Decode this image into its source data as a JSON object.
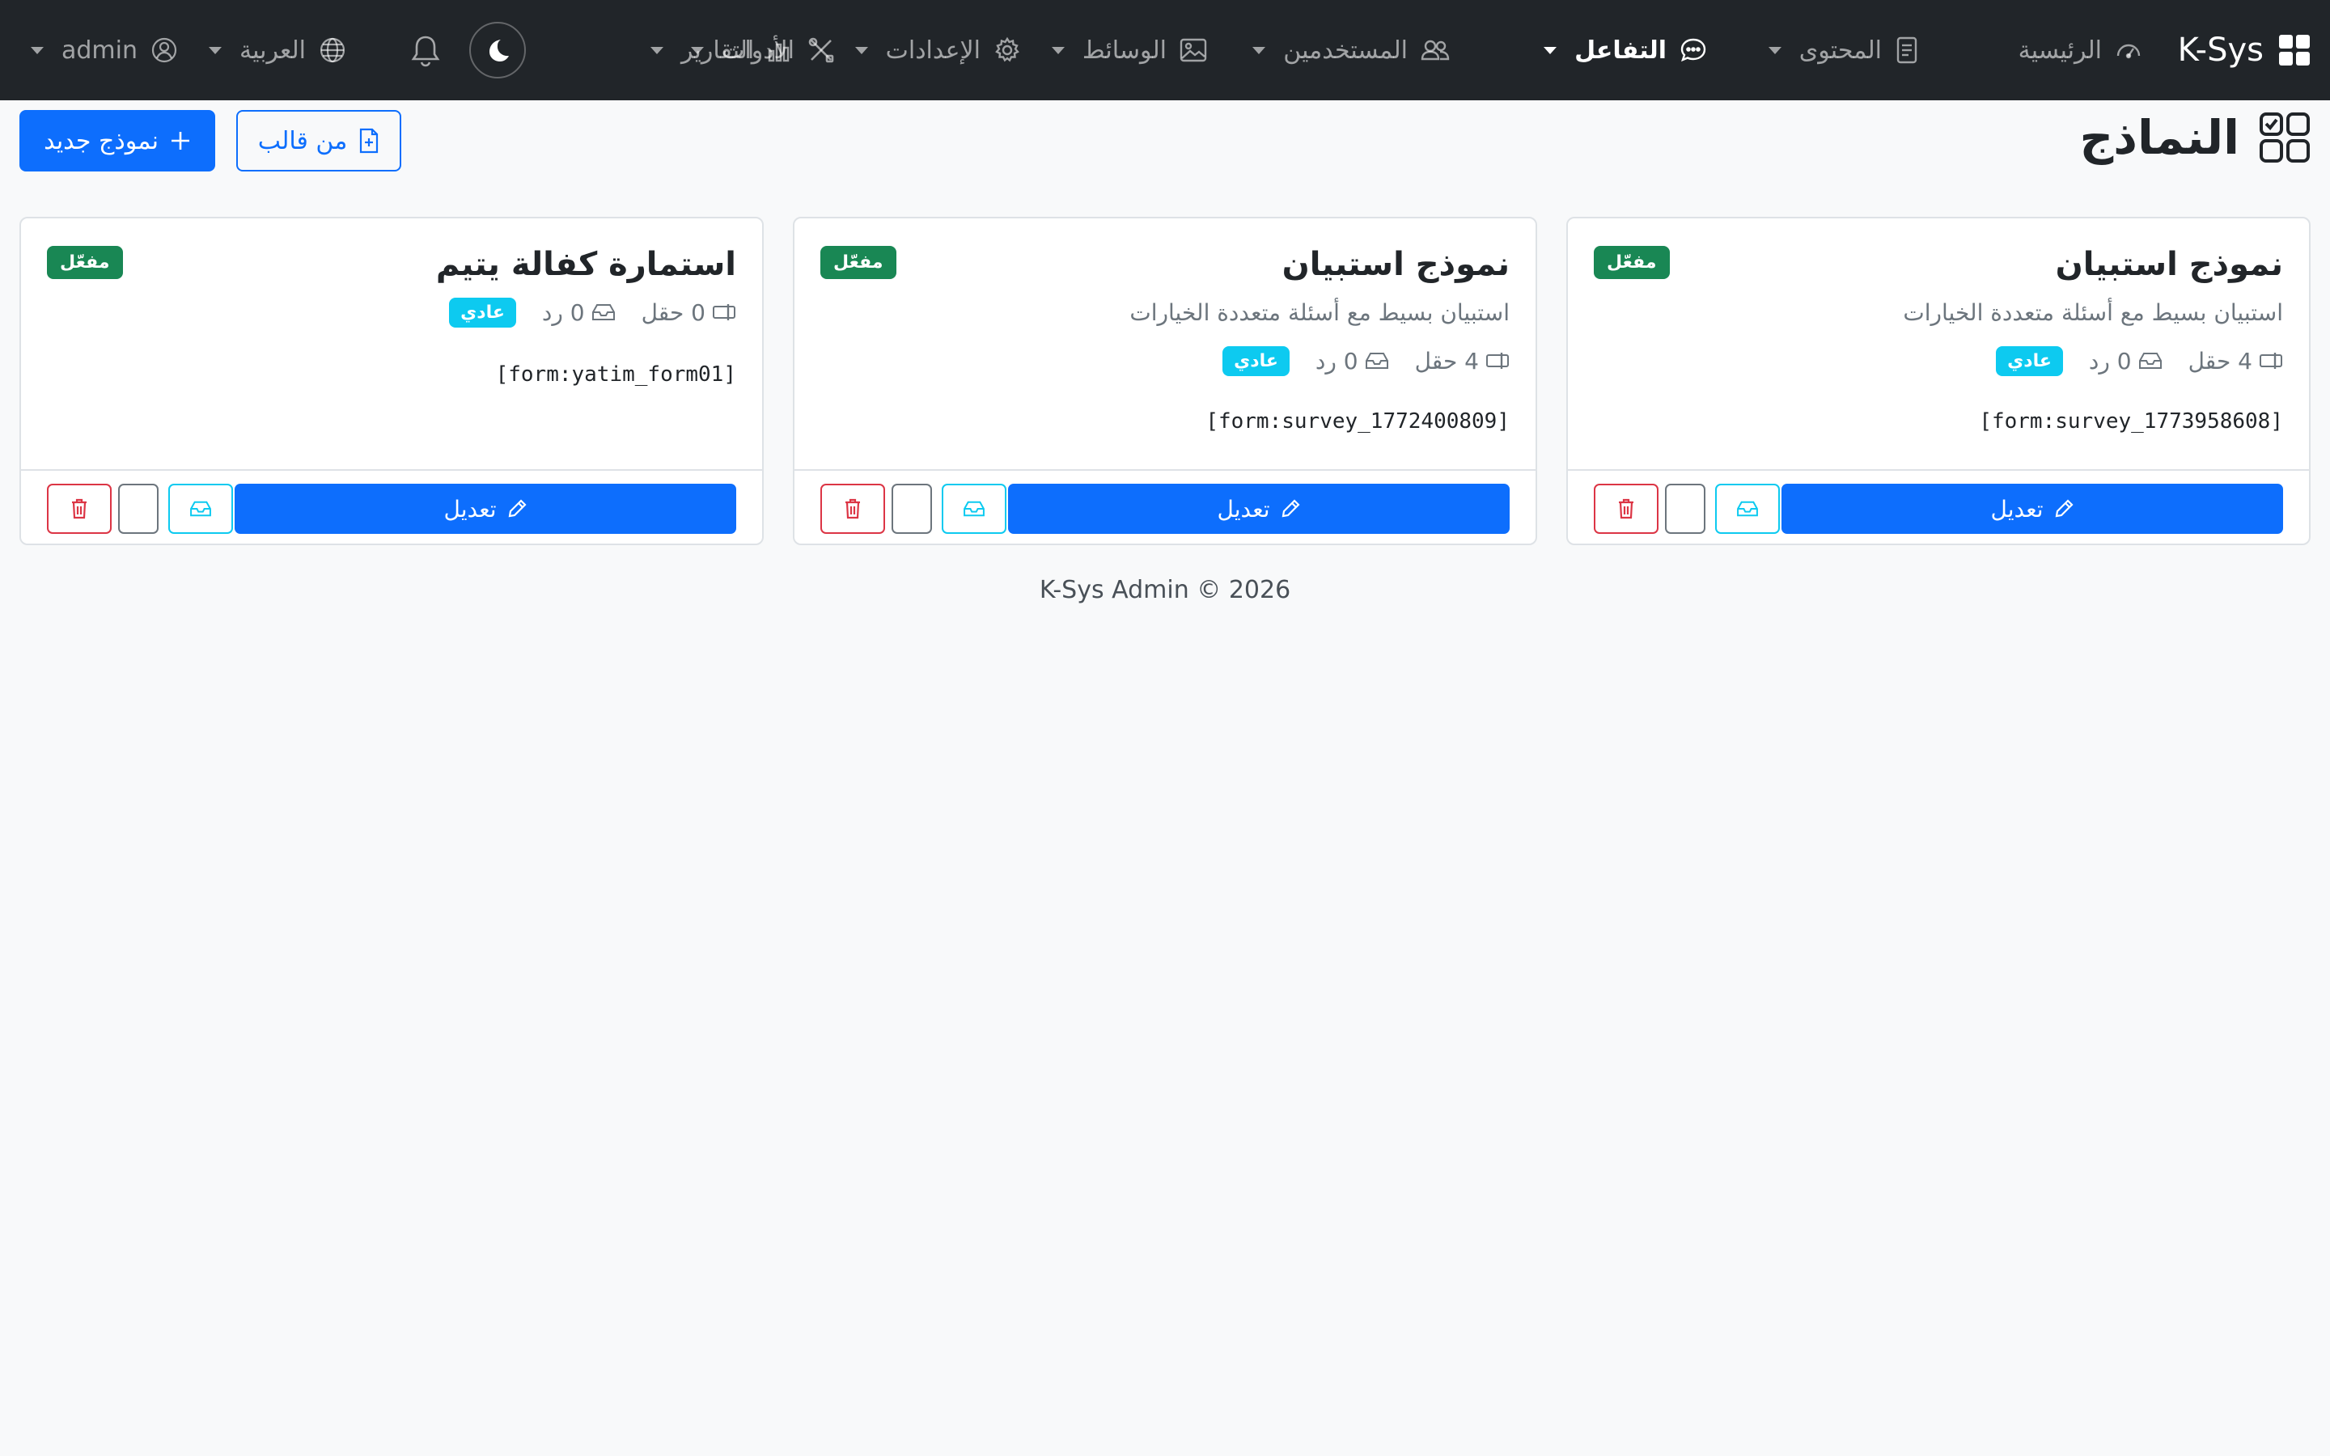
{
  "navbar": {
    "brand": "K-Sys",
    "items": [
      {
        "label": "الرئيسية",
        "icon": "speedometer-icon"
      },
      {
        "label": "المحتوى",
        "icon": "document-icon"
      },
      {
        "label": "التفاعل",
        "icon": "chat-icon",
        "active": true
      },
      {
        "label": "المستخدمين",
        "icon": "people-icon"
      },
      {
        "label": "الوسائط",
        "icon": "image-icon"
      },
      {
        "label": "الإعدادات",
        "icon": "gear-icon"
      },
      {
        "label": "الأدوات",
        "icon": "tools-icon"
      },
      {
        "label": "التقارير",
        "icon": "bar-chart-icon"
      }
    ],
    "language": "العربية",
    "user": "admin"
  },
  "page": {
    "title": "النماذج",
    "new_form_label": "نموذج جديد",
    "from_template_label": "من قالب"
  },
  "cards": [
    {
      "title": "نموذج استبيان",
      "description": "استبيان بسيط مع أسئلة متعددة الخيارات",
      "status": "مفعّل",
      "fields": "4 حقل",
      "responses": "0 رد",
      "type": "عادي",
      "shortcode": "[form:survey_1773958608]",
      "edit_label": "تعديل"
    },
    {
      "title": "نموذج استبيان",
      "description": "استبيان بسيط مع أسئلة متعددة الخيارات",
      "status": "مفعّل",
      "fields": "4 حقل",
      "responses": "0 رد",
      "type": "عادي",
      "shortcode": "[form:survey_1772400809]",
      "edit_label": "تعديل"
    },
    {
      "title": "استمارة كفالة يتيم",
      "description": "",
      "status": "مفعّل",
      "fields": "0 حقل",
      "responses": "0 رد",
      "type": "عادي",
      "shortcode": "[form:yatim_form01]",
      "edit_label": "تعديل"
    }
  ],
  "footer": "K-Sys Admin © 2026",
  "colors": {
    "navbar_bg": "#212529",
    "primary": "#0d6efd",
    "success": "#198754",
    "info": "#0dcaf0",
    "danger": "#dc3545"
  }
}
